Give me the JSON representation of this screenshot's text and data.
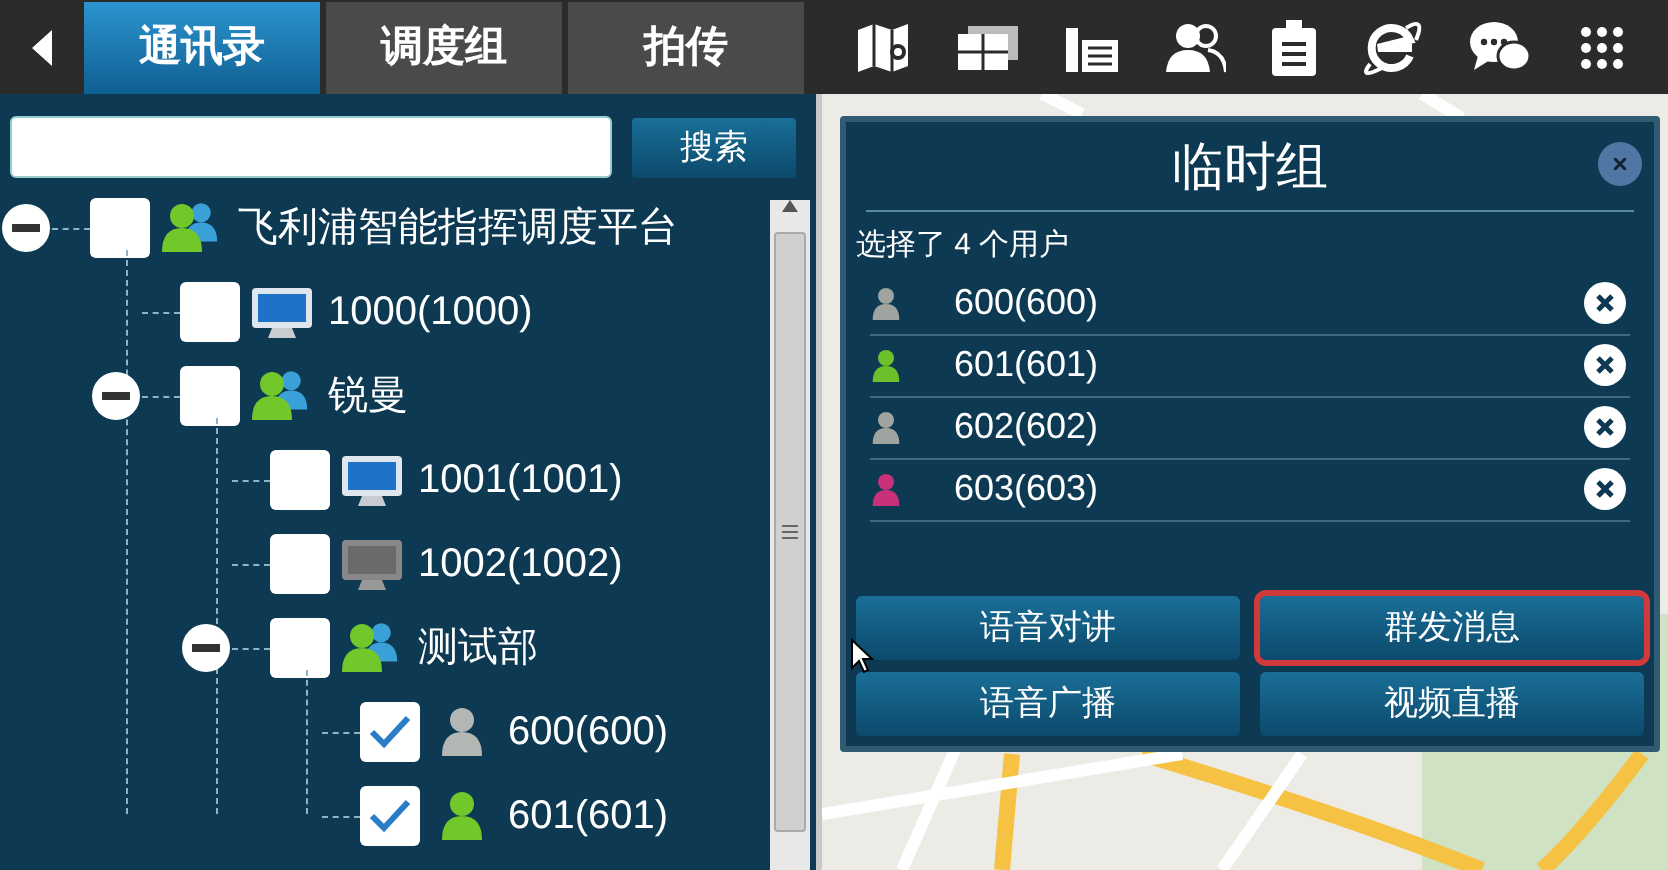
{
  "tabs": [
    {
      "label": "通讯录",
      "selected": true
    },
    {
      "label": "调度组",
      "selected": false
    },
    {
      "label": "拍传",
      "selected": false
    }
  ],
  "search": {
    "button": "搜索"
  },
  "tree": [
    {
      "label": "飞利浦智能指挥调度平台",
      "kind": "group",
      "expanded": true,
      "checked": false,
      "children": [
        {
          "label": "1000(1000)",
          "kind": "terminal",
          "online": true,
          "checked": false
        },
        {
          "label": "锐曼",
          "kind": "group",
          "expanded": true,
          "checked": false,
          "children": [
            {
              "label": "1001(1001)",
              "kind": "terminal",
              "online": true,
              "checked": false
            },
            {
              "label": "1002(1002)",
              "kind": "terminal",
              "online": false,
              "checked": false
            },
            {
              "label": "测试部",
              "kind": "group",
              "expanded": true,
              "checked": false,
              "children": [
                {
                  "label": "600(600)",
                  "kind": "user",
                  "online": false,
                  "checked": true
                },
                {
                  "label": "601(601)",
                  "kind": "user",
                  "online": true,
                  "checked": true
                }
              ]
            }
          ]
        }
      ]
    }
  ],
  "dialog": {
    "title": "临时组",
    "summary": "选择了 4 个用户",
    "members": [
      {
        "label": "600(600)",
        "color": "#a0a4a0"
      },
      {
        "label": "601(601)",
        "color": "#6cc02a"
      },
      {
        "label": "602(602)",
        "color": "#a0a4a0"
      },
      {
        "label": "603(603)",
        "color": "#c8307a"
      }
    ],
    "buttons": [
      {
        "label": "语音对讲",
        "highlighted": false
      },
      {
        "label": "群发消息",
        "highlighted": true
      },
      {
        "label": "语音广播",
        "highlighted": false
      },
      {
        "label": "视频直播",
        "highlighted": false
      }
    ]
  }
}
